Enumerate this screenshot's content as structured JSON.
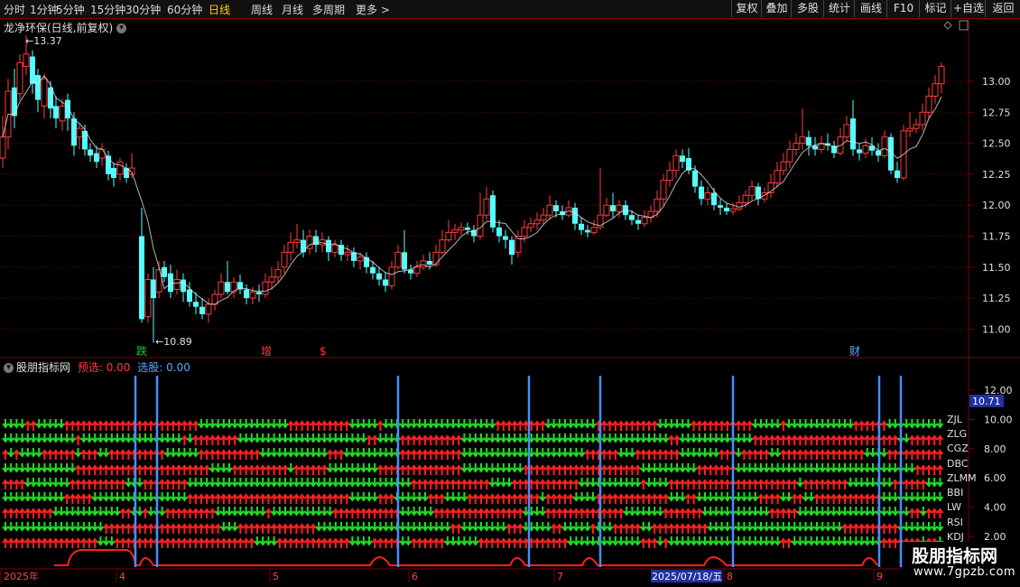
{
  "toolbar": {
    "periods": [
      "分时",
      "1分钟",
      "5分钟",
      "15分钟",
      "30分钟",
      "60分钟",
      "日线",
      "周线",
      "月线",
      "多周期",
      "更多 >"
    ],
    "active_period": "日线",
    "right_buttons": [
      "复权",
      "叠加",
      "多股",
      "统计",
      "画线",
      "F10",
      "标记",
      "+自选",
      "返回"
    ]
  },
  "main_chart": {
    "title": "龙净环保(日线,前复权)",
    "high_marker": "13.37",
    "low_marker": "10.89",
    "price_ticks": [
      "13.00",
      "12.75",
      "12.50",
      "12.25",
      "12.00",
      "11.75",
      "11.50",
      "11.25",
      "11.00"
    ],
    "event_labels": [
      {
        "text": "跌",
        "color": "#22c322"
      },
      {
        "text": "增",
        "color": "#ff3b3b"
      },
      {
        "text": "$",
        "color": "#ff3b3b"
      },
      {
        "text": "财",
        "color": "#5aa8ff"
      }
    ],
    "colors": {
      "up": "#ff3b3b",
      "down": "#54ffff",
      "ma": "#e0e0e0",
      "grid": "#7a0000"
    }
  },
  "indicator": {
    "name": "股朋指标网",
    "preselect_label": "预选:",
    "preselect_value": "0.00",
    "select_label": "选股:",
    "select_value": "0.00",
    "axis_ticks": [
      "12.00",
      "10.00",
      "8.00",
      "6.00",
      "4.00",
      "2.00"
    ],
    "current_value": "10.71",
    "row_labels": [
      "ZJL",
      "ZLG",
      "CGZ",
      "DBC",
      "ZLMM",
      "BBI",
      "LW",
      "RSI",
      "KDJ"
    ],
    "colors": {
      "up": "#ff2020",
      "down": "#22dd22",
      "signal": "#4a8cff"
    }
  },
  "time_axis": {
    "labels": [
      "2025年",
      "4",
      "5",
      "6",
      "7",
      "2025/07/18/五",
      "8",
      "9"
    ]
  },
  "watermark": {
    "title": "股朋指标网",
    "url": "www.7gpzb.com"
  }
}
